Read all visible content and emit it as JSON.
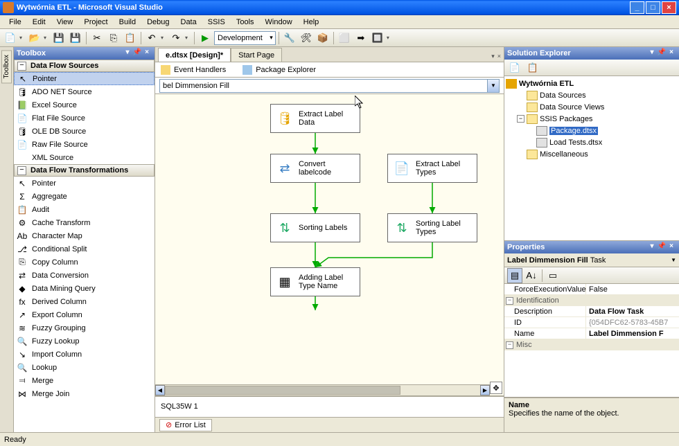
{
  "window": {
    "title": "Wytwórnia ETL - Microsoft Visual Studio"
  },
  "menu": [
    "File",
    "Edit",
    "View",
    "Project",
    "Build",
    "Debug",
    "Data",
    "SSIS",
    "Tools",
    "Window",
    "Help"
  ],
  "config_selected": "Development",
  "toolbox": {
    "title": "Toolbox",
    "cat1": "Data Flow Sources",
    "cat1_items": [
      {
        "label": "Pointer",
        "sel": true,
        "icon": "↖"
      },
      {
        "label": "ADO NET Source",
        "icon": "🛢"
      },
      {
        "label": "Excel Source",
        "icon": "📗"
      },
      {
        "label": "Flat File Source",
        "icon": "📄"
      },
      {
        "label": "OLE DB Source",
        "icon": "🛢"
      },
      {
        "label": "Raw File Source",
        "icon": "📄"
      },
      {
        "label": "XML Source",
        "icon": "</>"
      }
    ],
    "cat2": "Data Flow Transformations",
    "cat2_items": [
      {
        "label": "Pointer",
        "icon": "↖"
      },
      {
        "label": "Aggregate",
        "icon": "Σ"
      },
      {
        "label": "Audit",
        "icon": "📋"
      },
      {
        "label": "Cache Transform",
        "icon": "⚙"
      },
      {
        "label": "Character Map",
        "icon": "Ab"
      },
      {
        "label": "Conditional Split",
        "icon": "⎇"
      },
      {
        "label": "Copy Column",
        "icon": "⎘"
      },
      {
        "label": "Data Conversion",
        "icon": "⇄"
      },
      {
        "label": "Data Mining Query",
        "icon": "◆"
      },
      {
        "label": "Derived Column",
        "icon": "fx"
      },
      {
        "label": "Export Column",
        "icon": "↗"
      },
      {
        "label": "Fuzzy Grouping",
        "icon": "≋"
      },
      {
        "label": "Fuzzy Lookup",
        "icon": "🔍"
      },
      {
        "label": "Import Column",
        "icon": "↘"
      },
      {
        "label": "Lookup",
        "icon": "🔍"
      },
      {
        "label": "Merge",
        "icon": "⫤"
      },
      {
        "label": "Merge Join",
        "icon": "⋈"
      }
    ]
  },
  "doc_tabs": {
    "active": "e.dtsx [Design]*",
    "other": "Start Page"
  },
  "inner_tabs": {
    "t1": "Event Handlers",
    "t2": "Package Explorer"
  },
  "combo_value": "bel Dimmension Fill",
  "flow": {
    "n1": "Extract Label Data",
    "n2": "Convert labelcode",
    "n3": "Extract Label Types",
    "n4": "Sorting Labels",
    "n5": "Sorting Label Types",
    "n6": "Adding Label Type Name"
  },
  "output_text": "SQL35W 1",
  "error_tab": "Error List",
  "solution": {
    "title": "Solution Explorer",
    "root": "Wytwórnia ETL",
    "f1": "Data Sources",
    "f2": "Data Source Views",
    "f3": "SSIS Packages",
    "p1": "Package.dtsx",
    "p2": "Load Tests.dtsx",
    "f4": "Miscellaneous"
  },
  "properties": {
    "title": "Properties",
    "object": "Label Dimmension Fill",
    "object_type": "Task",
    "rows": {
      "fev": {
        "name": "ForceExecutionValue",
        "val": "False"
      },
      "cat_id": "Identification",
      "desc": {
        "name": "Description",
        "val": "Data Flow Task"
      },
      "id": {
        "name": "ID",
        "val": "{054DFC62-5783-45B7"
      },
      "name": {
        "name": "Name",
        "val": "Label Dimmension F"
      },
      "cat_misc": "Misc"
    },
    "desc_title": "Name",
    "desc_text": "Specifies the name of the object."
  },
  "status": "Ready"
}
